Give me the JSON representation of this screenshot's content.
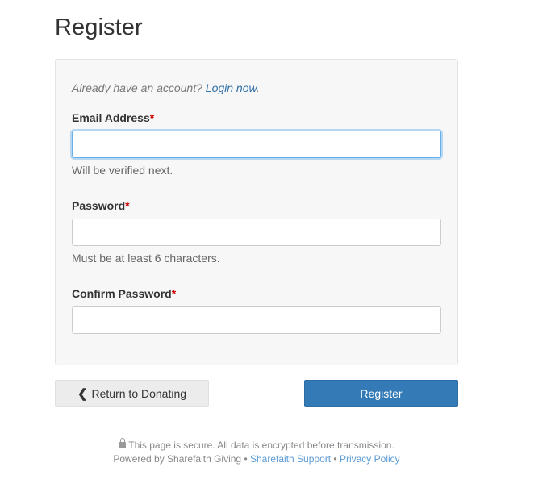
{
  "page": {
    "title": "Register"
  },
  "form": {
    "login_prompt": "Already have an account?",
    "login_link": "Login now",
    "login_suffix": ".",
    "required_marker": "*",
    "email": {
      "label": "Email Address",
      "value": "",
      "help": "Will be verified next."
    },
    "password": {
      "label": "Password",
      "value": "",
      "help": "Must be at least 6 characters."
    },
    "confirm_password": {
      "label": "Confirm Password",
      "value": ""
    }
  },
  "actions": {
    "back_label": "Return to Donating",
    "back_icon": "chevron-left-icon",
    "register_label": "Register"
  },
  "footer": {
    "secure_text": "This page is secure. All data is encrypted before transmission.",
    "powered_by": "Powered by Sharefaith Giving",
    "separator": "•",
    "support_link": "Sharefaith Support",
    "privacy_link": "Privacy Policy"
  },
  "colors": {
    "primary": "#337ab7",
    "link": "#2f6ea8",
    "required": "#cc0000",
    "focus": "#66afe9"
  }
}
